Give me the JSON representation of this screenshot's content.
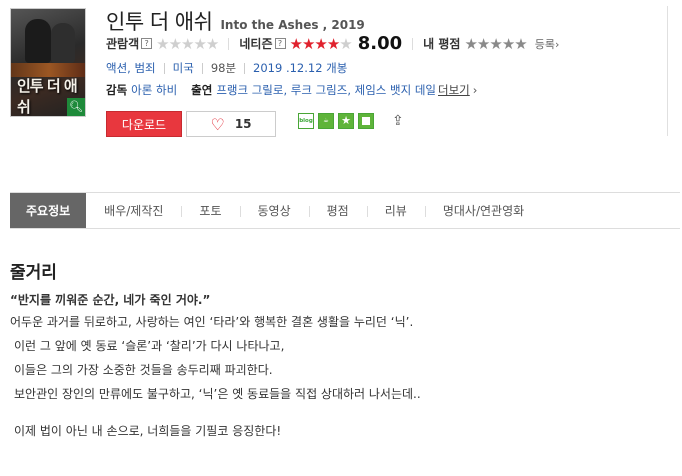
{
  "poster": {
    "title_text": "인투 더 애쉬"
  },
  "movie": {
    "title_ko": "인투 더 애쉬",
    "title_en": "Into the Ashes , 2019"
  },
  "ratings": {
    "audience_label": "관람객",
    "help_mark": "?",
    "audience_stars": "★★★★★",
    "netizen_label": "네티즌",
    "netizen_stars_on": "★★★★",
    "netizen_stars_off": "★",
    "netizen_score": "8.00",
    "my_label": "내 평점",
    "my_stars": "★★★★★",
    "register_label": "등록",
    "register_arrow": "›"
  },
  "meta": {
    "genres": "액션, 범죄",
    "country": "미국",
    "runtime": "98분",
    "release": "2019 .12.12 개봉"
  },
  "cast": {
    "director_label": "감독",
    "director": "아론 하비",
    "cast_label": "출연",
    "actors": "프랭크 그릴로, 루크 그림즈, 제임스 뱃지 데일",
    "more": "더보기",
    "more_arrow": "›"
  },
  "actions": {
    "download_label": "다운로드",
    "like_icon": "heart-icon",
    "like_count": "15",
    "share_blog": "blog",
    "share_star": "★",
    "share_arrow": "⇪"
  },
  "tabs": [
    {
      "label": "주요정보"
    },
    {
      "label": "배우/제작진"
    },
    {
      "label": "포토"
    },
    {
      "label": "동영상"
    },
    {
      "label": "평점"
    },
    {
      "label": "리뷰"
    },
    {
      "label": "명대사/연관영화"
    }
  ],
  "story": {
    "heading": "줄거리",
    "quote": "“반지를 끼워준 순간, 네가 죽인 거야.”",
    "lines": [
      "어두운 과거를 뒤로하고, 사랑하는 여인 ‘타라’와 행복한 결혼 생활을 누리던 ‘닉’.",
      "이런 그 앞에 옛 동료 ‘슬론’과 ‘찰리’가 다시 나타나고,",
      "이들은 그의 가장 소중한 것들을 송두리째 파괴한다.",
      "보안관인 장인의 만류에도 불구하고, ‘닉’은 옛 동료들을 직접 상대하러 나서는데..",
      "이제 법이 아닌 내 손으로, 너희들을 기필코 응징한다!"
    ]
  },
  "colors": {
    "accent_red": "#e8373e",
    "link_blue": "#2a5fae",
    "tab_active": "#666666"
  }
}
